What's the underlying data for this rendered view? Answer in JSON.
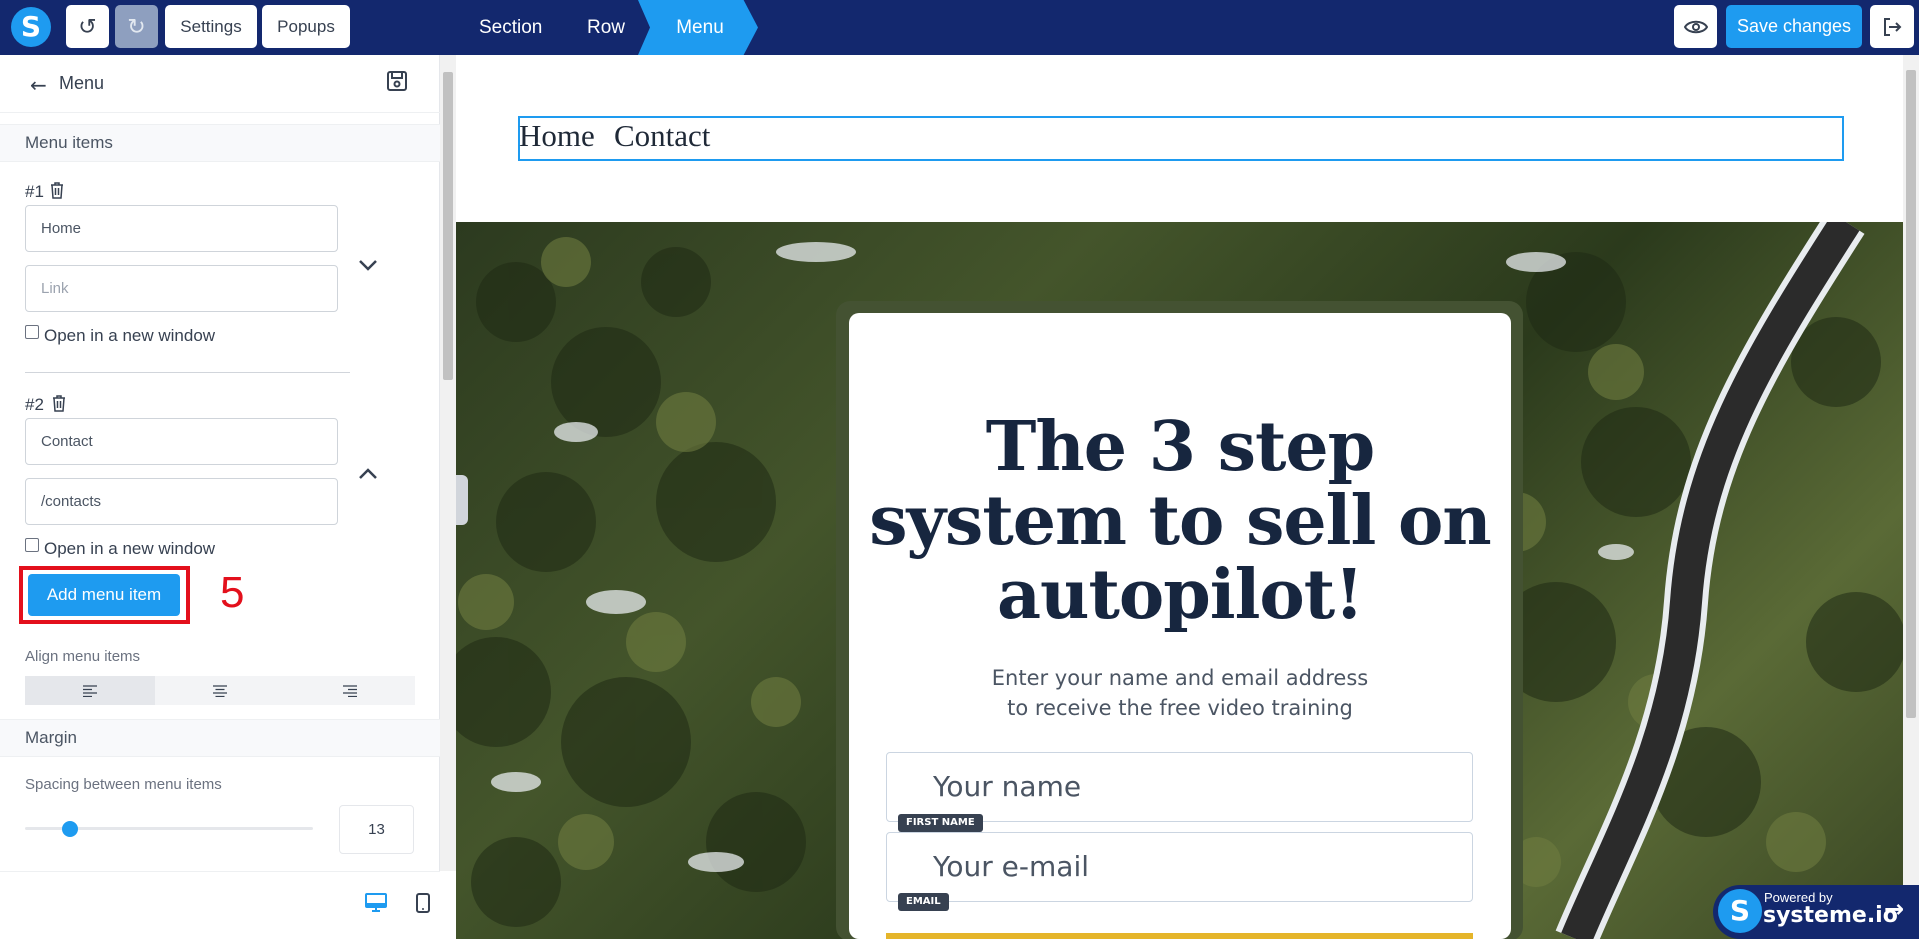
{
  "toolbar": {
    "logo": "S",
    "settings_label": "Settings",
    "popups_label": "Popups",
    "undo_icon": "undo-icon",
    "redo_icon": "redo-icon",
    "breadcrumbs": [
      "Section",
      "Row",
      "Menu"
    ],
    "save_label": "Save changes",
    "preview_icon": "eye-icon",
    "exit_icon": "exit-icon"
  },
  "sidebar": {
    "title": "Menu",
    "section_menu_items": "Menu items",
    "items": [
      {
        "num": "#1",
        "name": "Home",
        "link": "",
        "link_placeholder": "Link",
        "new_window_label": "Open in a new window",
        "expanded": false
      },
      {
        "num": "#2",
        "name": "Contact",
        "link": "/contacts",
        "link_placeholder": "Link",
        "new_window_label": "Open in a new window",
        "expanded": true
      }
    ],
    "add_button": "Add menu item",
    "step_marker": "5",
    "align_label": "Align menu items",
    "align_options": [
      "left",
      "center",
      "right"
    ],
    "align_selected": "left",
    "section_margin": "Margin",
    "spacing_label": "Spacing between menu items",
    "spacing_value": "13",
    "spacing_slider_fraction": 0.13,
    "devices": [
      "desktop",
      "mobile"
    ],
    "active_device": "desktop"
  },
  "canvas": {
    "menu_items": [
      "Home",
      "Contact"
    ],
    "headline": "The 3 step system to sell on autopilot!",
    "subtext_line1": "Enter your name and email address",
    "subtext_line2": "to receive the free video training",
    "name_placeholder": "Your name",
    "name_tag": "FIRST NAME",
    "email_placeholder": "Your e-mail",
    "email_tag": "EMAIL",
    "powered_by": "Powered by",
    "powered_brand": "systeme.io"
  },
  "colors": {
    "topbar": "#13286e",
    "accent": "#1e9bf0",
    "highlight": "#e3101c",
    "headline": "#17263f"
  }
}
